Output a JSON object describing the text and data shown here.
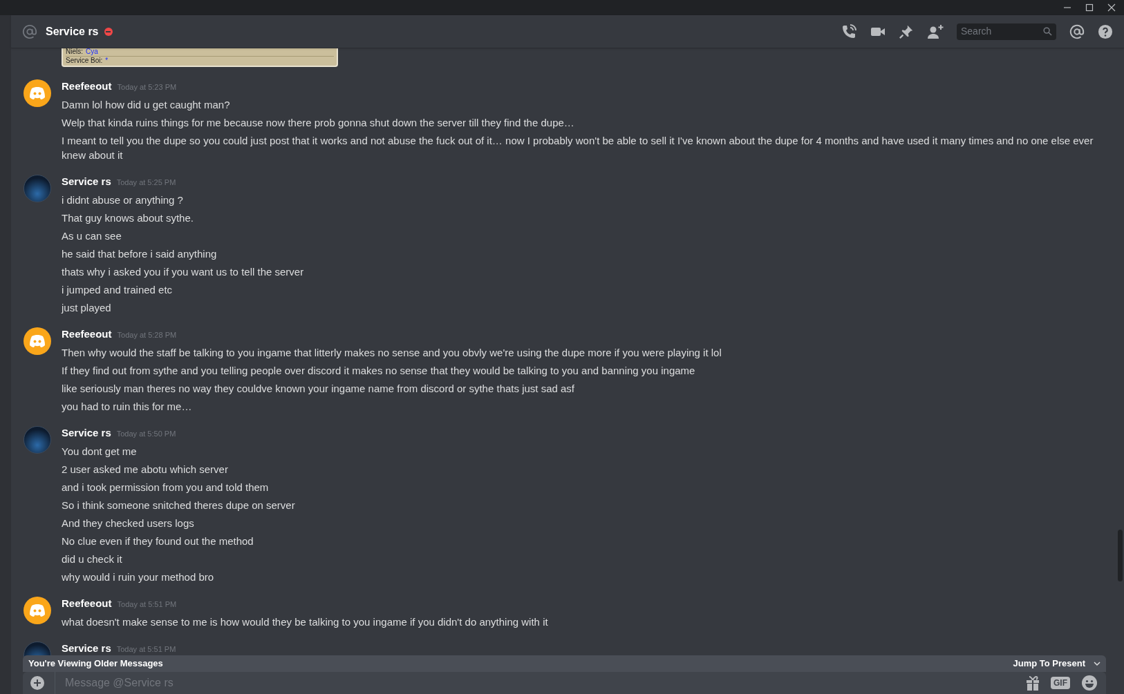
{
  "header": {
    "channel_name": "Service rs",
    "do_not_disturb": true,
    "search": {
      "placeholder": "Search"
    }
  },
  "attachment": {
    "lines": [
      {
        "speaker": "Niels:",
        "text": "Cya"
      },
      {
        "speaker": "Service Boi:",
        "text": "*"
      }
    ]
  },
  "messages": [
    {
      "author": "Reefeeout",
      "kind": "discord",
      "time": "Today at 5:23 PM",
      "lines": [
        "Damn lol how did u get caught man?",
        "Welp that kinda ruins things for me because now there prob gonna shut down the server till they find the dupe…",
        "I meant to tell you the dupe so you could just post that it works and not abuse the fuck out of it… now I probably won't be able to sell it I've known about the dupe for 4 months and have used it many times and no one else ever knew about it"
      ]
    },
    {
      "author": "Service rs",
      "kind": "logo",
      "time": "Today at 5:25 PM",
      "lines": [
        "i didnt abuse or anything ?",
        "That guy knows about sythe.",
        "As u can see",
        "he said that before i said anything",
        "thats why i asked you if you want us to tell the server",
        "i jumped and trained etc",
        "just played"
      ]
    },
    {
      "author": "Reefeeout",
      "kind": "discord",
      "time": "Today at 5:28 PM",
      "lines": [
        "Then why would the staff be talking to you ingame that litterly makes no sense and you obvly we're using the dupe more if you were playing it lol",
        "If they find out from sythe and you telling people over discord it makes no sense that they would be talking to you and banning you ingame",
        "like seriously man theres no way they couldve known your ingame name from discord or sythe thats just sad asf",
        "you had to ruin this for me…"
      ]
    },
    {
      "author": "Service rs",
      "kind": "logo",
      "time": "Today at 5:50 PM",
      "lines": [
        "You dont get me",
        "2 user asked me abotu which server",
        "and i took permission from you and told them",
        "So i think someone snitched theres dupe on server",
        "And they checked users logs",
        "No clue even if they found out the method",
        "did u check it",
        "why would i ruin your method bro"
      ]
    },
    {
      "author": "Reefeeout",
      "kind": "discord",
      "time": "Today at 5:51 PM",
      "lines": [
        "what doesn't make sense to me is how would they be talking to you ingame if you didn't do anything with it"
      ]
    },
    {
      "author": "Service rs",
      "kind": "logo",
      "time": "Today at 5:51 PM"
    }
  ],
  "older_banner": {
    "text": "You're Viewing Older Messages",
    "jump_label": "Jump To Present"
  },
  "composer": {
    "placeholder": "Message @Service rs",
    "gif_label": "GIF"
  }
}
